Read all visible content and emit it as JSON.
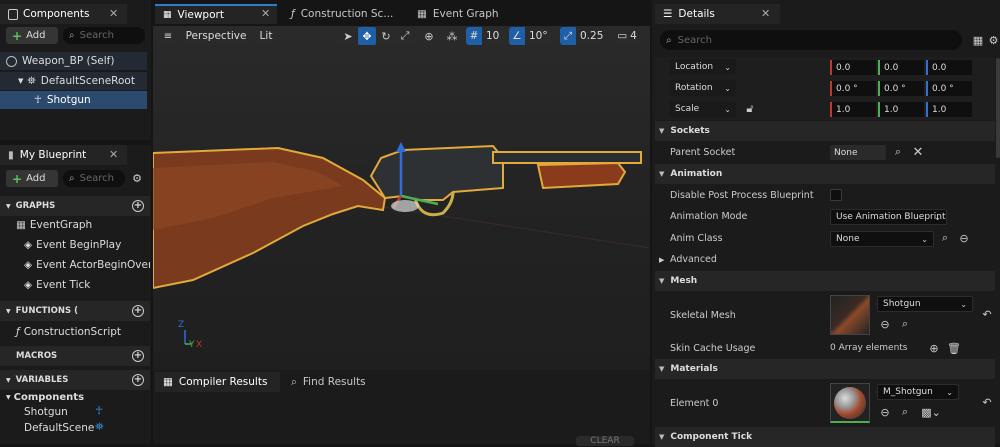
{
  "components": {
    "title": "Components",
    "add_label": "Add",
    "search_placeholder": "Search",
    "tree": [
      {
        "label": "Weapon_BP (Self)"
      },
      {
        "label": "DefaultSceneRoot"
      },
      {
        "label": "Shotgun"
      }
    ]
  },
  "my_blueprint": {
    "title": "My Blueprint",
    "add_label": "Add",
    "search_placeholder": "Search",
    "sections": {
      "graphs": "GRAPHS",
      "functions": "FUNCTIONS (",
      "macros": "MACROS",
      "variables": "VARIABLES"
    },
    "graph_items": [
      "EventGraph",
      "Event BeginPlay",
      "Event ActorBeginOverla",
      "Event Tick"
    ],
    "function_items": [
      "ConstructionScript"
    ],
    "variables_group": "Components",
    "variable_items": [
      "Shotgun",
      "DefaultSceneRo"
    ]
  },
  "editor_tabs": [
    {
      "label": "Viewport"
    },
    {
      "label": "Construction Sc..."
    },
    {
      "label": "Event Graph"
    }
  ],
  "viewport": {
    "perspective_label": "Perspective",
    "lit_label": "Lit",
    "grid_snap": "10",
    "rotation_snap": "10°",
    "scale_snap": "0.25",
    "camera_speed": "4",
    "axis_x": "X",
    "axis_y": "Y",
    "axis_z": "Z"
  },
  "bottom_tabs": {
    "compiler_results": "Compiler Results",
    "find_results": "Find Results",
    "clear_label": "CLEAR"
  },
  "details": {
    "title": "Details",
    "search_placeholder": "Search",
    "transform": {
      "location_label": "Location",
      "location": [
        "0.0",
        "0.0",
        "0.0"
      ],
      "rotation_label": "Rotation",
      "rotation": [
        "0.0 °",
        "0.0 °",
        "0.0 °"
      ],
      "scale_label": "Scale",
      "scale": [
        "1.0",
        "1.0",
        "1.0"
      ]
    },
    "sockets": {
      "title": "Sockets",
      "parent_socket_label": "Parent Socket",
      "parent_socket_value": "None"
    },
    "animation": {
      "title": "Animation",
      "disable_pp_label": "Disable Post Process Blueprint",
      "mode_label": "Animation Mode",
      "mode_value": "Use Animation Blueprint",
      "anim_class_label": "Anim Class",
      "anim_class_value": "None",
      "advanced_label": "Advanced"
    },
    "mesh": {
      "title": "Mesh",
      "skeletal_mesh_label": "Skeletal Mesh",
      "skeletal_mesh_value": "Shotgun",
      "skin_cache_label": "Skin Cache Usage",
      "skin_cache_value": "0 Array elements"
    },
    "materials": {
      "title": "Materials",
      "element0_label": "Element 0",
      "element0_value": "M_Shotgun"
    },
    "component_tick_title": "Component Tick"
  },
  "colors": {
    "accent": "#2a7fd0",
    "selection": "#2c4a6e",
    "x_axis": "#c0392b",
    "y_axis": "#4caf50",
    "z_axis": "#2f6fd6",
    "add_green": "#5ec15e"
  }
}
